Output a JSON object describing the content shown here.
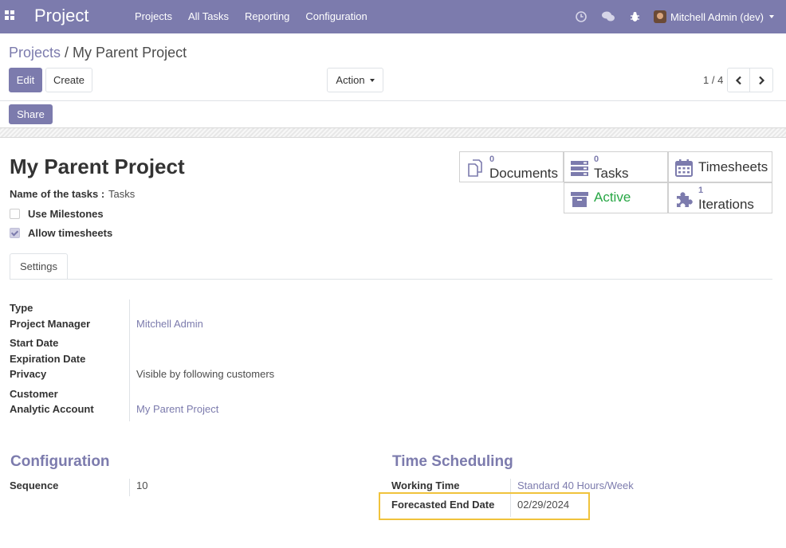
{
  "navbar": {
    "brand": "Project",
    "menu": [
      "Projects",
      "All Tasks",
      "Reporting",
      "Configuration"
    ],
    "user": "Mitchell Admin (dev)"
  },
  "breadcrumb": {
    "parent": "Projects",
    "separator": "/",
    "current": "My Parent Project"
  },
  "toolbar": {
    "edit": "Edit",
    "create": "Create",
    "action": "Action",
    "share": "Share"
  },
  "pager": {
    "value": "1 / 4"
  },
  "form": {
    "title": "My Parent Project",
    "tasks_name_label": "Name of the tasks :",
    "tasks_name_value": "Tasks",
    "use_milestones": {
      "label": "Use Milestones",
      "checked": false
    },
    "allow_timesheets": {
      "label": "Allow timesheets",
      "checked": true
    }
  },
  "smart_buttons": {
    "documents": {
      "count": "0",
      "label": "Documents"
    },
    "tasks": {
      "count": "0",
      "label": "Tasks"
    },
    "timesheets": {
      "label": "Timesheets"
    },
    "active": {
      "label": "Active"
    },
    "iterations": {
      "count": "1",
      "label": "Iterations"
    }
  },
  "tabs": [
    "Settings"
  ],
  "settings": {
    "type_label": "Type",
    "project_manager_label": "Project Manager",
    "project_manager_value": "Mitchell Admin",
    "start_date_label": "Start Date",
    "expiration_date_label": "Expiration Date",
    "privacy_label": "Privacy",
    "privacy_value": "Visible by following customers",
    "customer_label": "Customer",
    "analytic_account_label": "Analytic Account",
    "analytic_account_value": "My Parent Project"
  },
  "configuration": {
    "title": "Configuration",
    "sequence_label": "Sequence",
    "sequence_value": "10"
  },
  "time_scheduling": {
    "title": "Time Scheduling",
    "working_time_label": "Working Time",
    "working_time_value": "Standard 40 Hours/Week",
    "forecasted_end_date_label": "Forecasted End Date",
    "forecasted_end_date_value": "02/29/2024"
  },
  "colors": {
    "brand": "#7c7bad",
    "active": "#28a745",
    "highlight": "#f0c33c"
  }
}
